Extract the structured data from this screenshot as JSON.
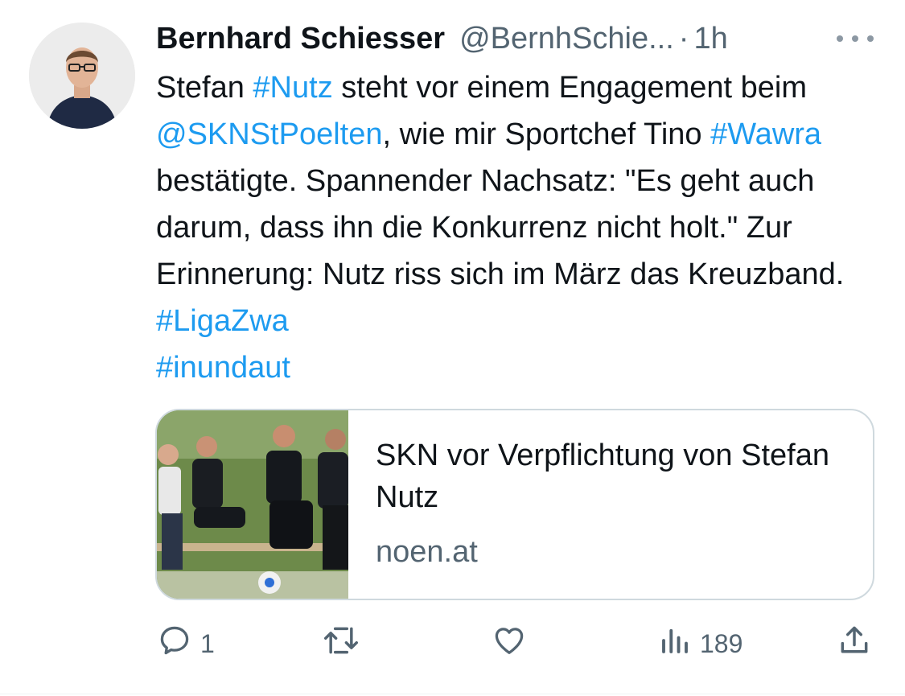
{
  "tweet": {
    "author_name": "Bernhard Schiesser",
    "author_handle": "@BernhSchie...",
    "separator": "·",
    "time": "1h",
    "body": [
      {
        "text": "Stefan ",
        "link": false
      },
      {
        "text": "#Nutz",
        "link": true
      },
      {
        "text": " steht vor einem Engagement beim ",
        "link": false
      },
      {
        "text": "@SKNStPoelten",
        "link": true
      },
      {
        "text": ", wie mir Sportchef Tino ",
        "link": false
      },
      {
        "text": "#Wawra",
        "link": true
      },
      {
        "text": " bestätigte. Spannender Nachsatz: \"Es geht auch darum, dass ihn die Konkurrenz nicht holt.\" Zur Erinnerung: Nutz riss sich im März das Kreuzband. ",
        "link": false
      },
      {
        "text": "#LigaZwa",
        "link": true
      },
      {
        "text": " ",
        "link": false
      },
      {
        "text": "#inundaut",
        "link": true
      }
    ],
    "card": {
      "title": "SKN vor Verpflichtung von Stefan Nutz",
      "domain": "noen.at",
      "image_icon": "photo-people-on-bench"
    },
    "actions": {
      "reply_count": "1",
      "retweet_count": "",
      "like_count": "",
      "views_count": "189",
      "icons": [
        "reply-icon",
        "retweet-icon",
        "like-icon",
        "views-icon",
        "share-icon"
      ]
    }
  },
  "colors": {
    "text": "#0f1419",
    "secondary": "#536471",
    "link": "#1d9bf0",
    "border": "#cfd9de"
  }
}
